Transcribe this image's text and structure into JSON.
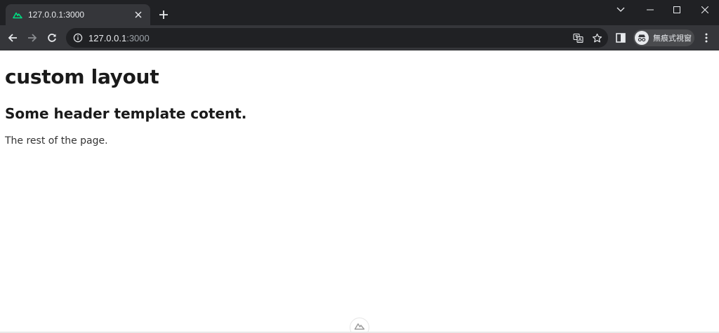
{
  "browser": {
    "tab": {
      "title": "127.0.0.1:3000",
      "favicon": "nuxt-logo-icon",
      "accent_color": "#00dc82"
    },
    "address_bar": {
      "host": "127.0.0.1",
      "port": ":3000"
    },
    "profile": {
      "label": "無痕式視窗"
    },
    "icons": {
      "back": "arrow-left-icon",
      "forward": "arrow-right-icon",
      "reload": "reload-icon",
      "site_info": "info-icon",
      "translate": "translate-icon",
      "bookmark": "star-icon",
      "side_panel": "side-panel-icon",
      "menu": "kebab-menu-icon"
    }
  },
  "page": {
    "heading": "custom layout",
    "subheading": "Some header template cotent.",
    "body_text": "The rest of the page."
  }
}
